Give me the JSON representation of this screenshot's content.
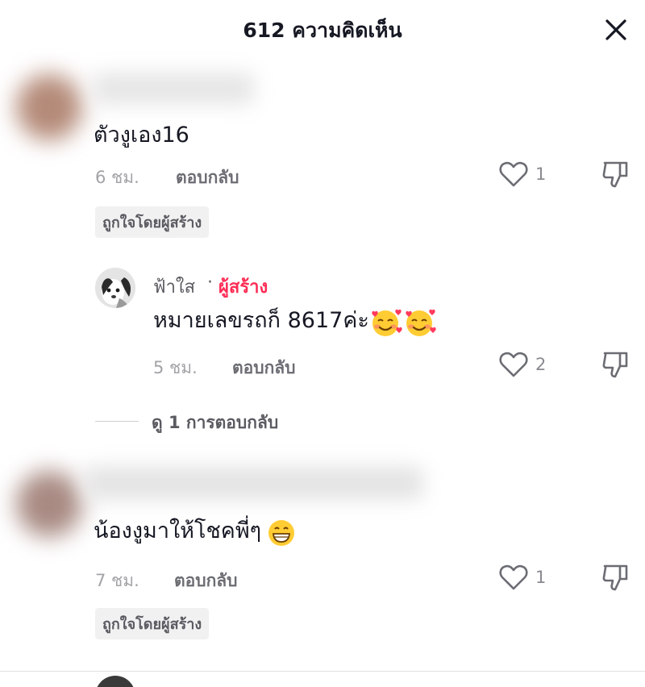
{
  "header": {
    "title": "612 ความคิดเห็น"
  },
  "comments": [
    {
      "text": "ตัวงูเอง16",
      "time": "6 ชม.",
      "reply_label": "ตอบกลับ",
      "likes": "1",
      "badge": "ถูกใจโดยผู้สร้าง"
    },
    {
      "text": "น้องงูมาให้โชคพี่ๆ",
      "time": "7 ชม.",
      "reply_label": "ตอบกลับ",
      "likes": "1",
      "badge": "ถูกใจโดยผู้สร้าง"
    }
  ],
  "reply": {
    "name": "ฟ้าใส",
    "separator": "·",
    "role": "ผู้สร้าง",
    "text": "หมายเลขรถก็ 8617ค่ะ",
    "time": "5 ชม.",
    "reply_label": "ตอบกลับ",
    "likes": "2"
  },
  "view_replies": {
    "label": "ดู 1 การตอบกลับ"
  },
  "icons": {
    "close": "close-icon",
    "heart": "heart-outline-icon",
    "dislike": "thumbs-down-icon",
    "emoji_love": "smiling-face-with-hearts-emoji",
    "emoji_grin": "grinning-face-emoji"
  },
  "colors": {
    "creator": "#fe2c55",
    "text": "#161823",
    "muted": "#a3a3a8"
  }
}
